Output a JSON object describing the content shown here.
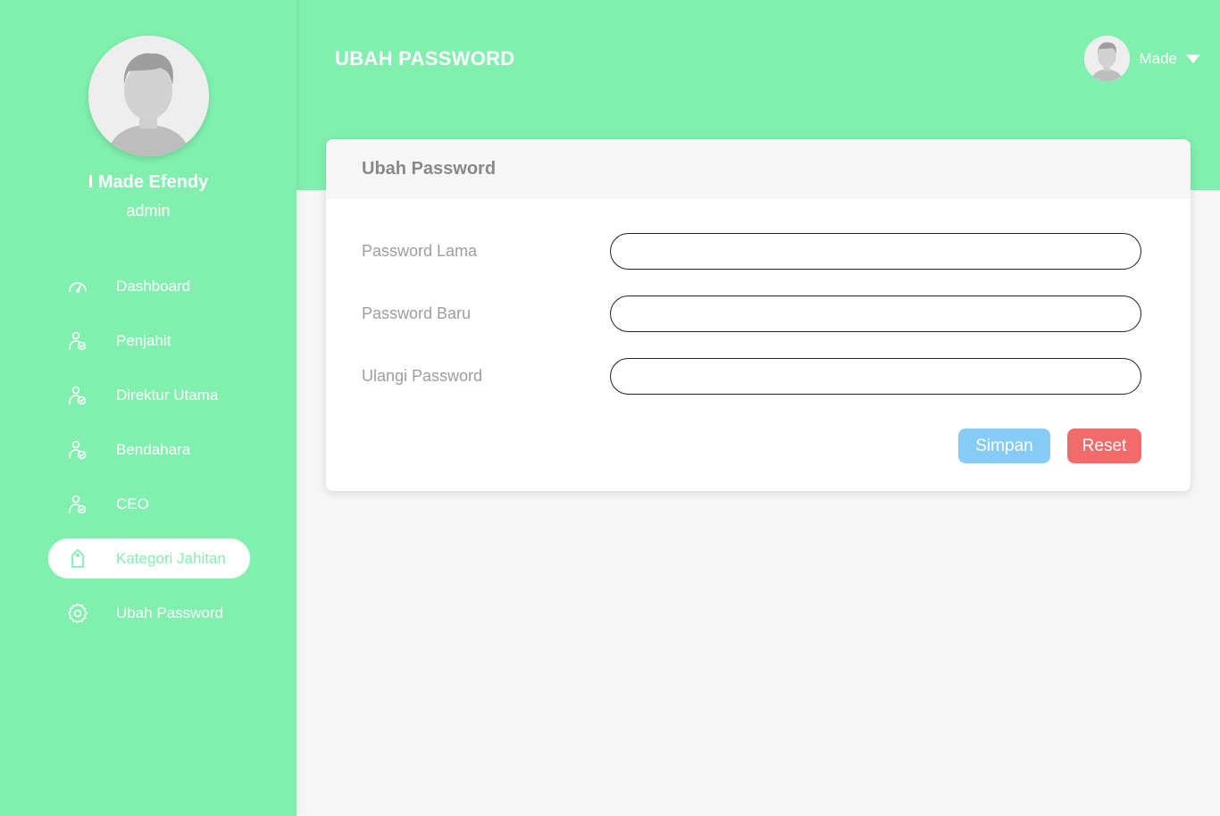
{
  "colors": {
    "brand_green": "#81f0ae",
    "save_button": "#87ccf8",
    "reset_button": "#f26b6b",
    "content_background": "#f6f6f6"
  },
  "sidebar": {
    "avatar_icon": "user-avatar-icon",
    "profile_name": "I Made Efendy",
    "profile_role": "admin",
    "items": [
      {
        "label": "Dashboard",
        "icon": "speedometer-icon",
        "active": false
      },
      {
        "label": "Penjahit",
        "icon": "user-check-icon",
        "active": false
      },
      {
        "label": "Direktur Utama",
        "icon": "user-check-icon",
        "active": false
      },
      {
        "label": "Bendahara",
        "icon": "user-check-icon",
        "active": false
      },
      {
        "label": "CEO",
        "icon": "user-check-icon",
        "active": false
      },
      {
        "label": "Kategori Jahitan",
        "icon": "tag-icon",
        "active": true
      },
      {
        "label": "Ubah Password",
        "icon": "gear-icon",
        "active": false
      }
    ]
  },
  "header": {
    "title": "UBAH PASSWORD",
    "user_name": "Made",
    "dropdown_icon": "caret-down-icon"
  },
  "card": {
    "title": "Ubah Password",
    "fields": [
      {
        "label": "Password Lama",
        "value": "",
        "placeholder": ""
      },
      {
        "label": "Password Baru",
        "value": "",
        "placeholder": ""
      },
      {
        "label": "Ulangi Password",
        "value": "",
        "placeholder": ""
      }
    ],
    "save_label": "Simpan",
    "reset_label": "Reset"
  }
}
